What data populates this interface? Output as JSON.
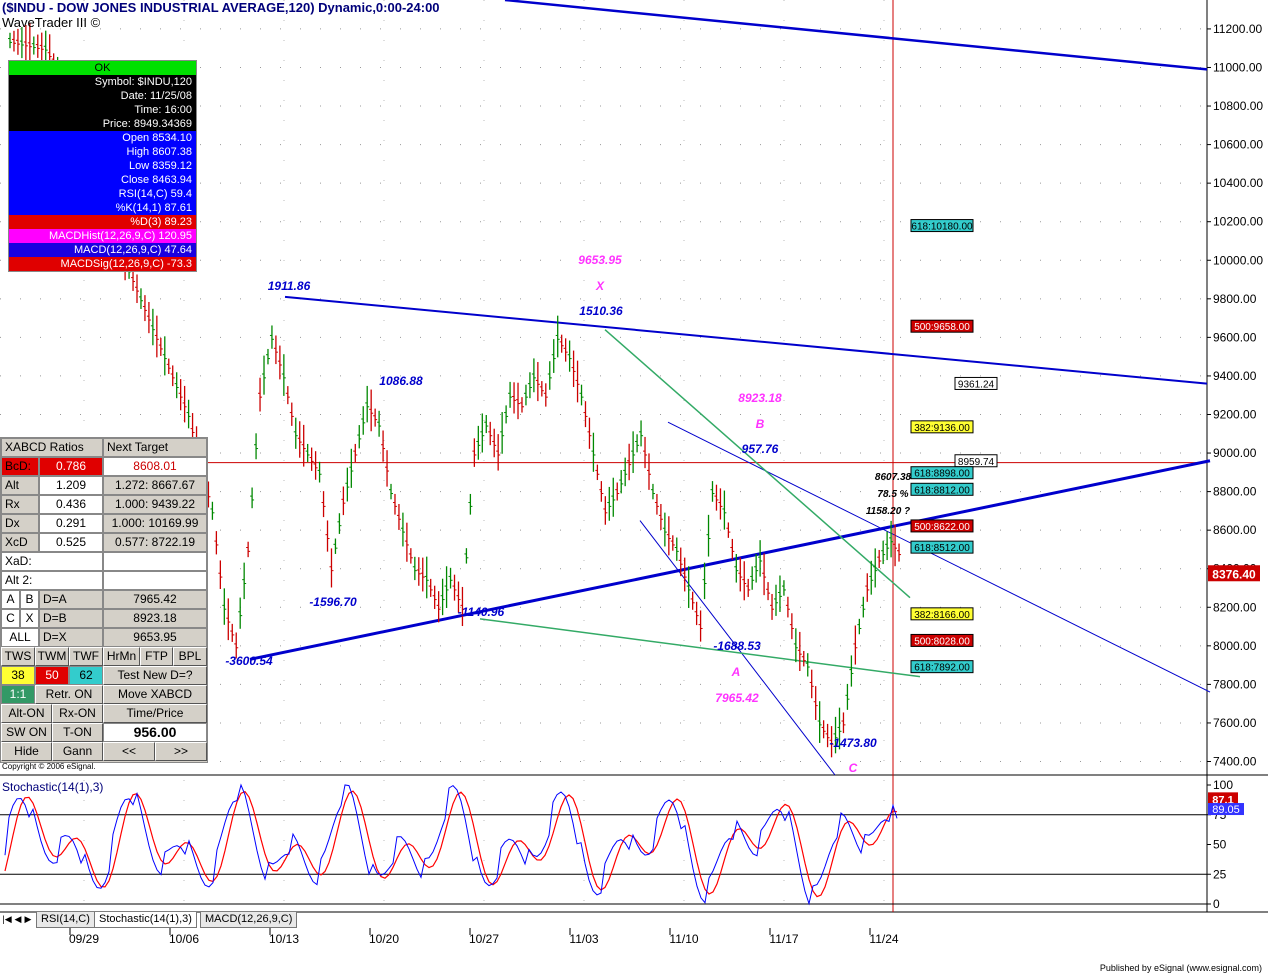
{
  "window": {
    "title": "($INDU - DOW JONES INDUSTRIAL AVERAGE,120) Dynamic,0:00-24:00",
    "study_name": "WaveTrader III ©",
    "copyright": "Copyright © 2006 eSignal.",
    "published": "Published by eSignal (www.esignal.com)"
  },
  "data_window": {
    "ok": "OK",
    "rows": [
      {
        "label": "Symbol: $INDU,120",
        "style": "blk"
      },
      {
        "label": "Date: 11/25/08",
        "style": "blk"
      },
      {
        "label": "Time: 16:00",
        "style": "blk"
      },
      {
        "label": "Price: 8949.34369",
        "style": "blk"
      },
      {
        "label": "Open 8534.10",
        "style": "blu"
      },
      {
        "label": "High 8607.38",
        "style": "blu"
      },
      {
        "label": "Low 8359.12",
        "style": "blu"
      },
      {
        "label": "Close 8463.94",
        "style": "blu"
      },
      {
        "label": "RSI(14,C) 59.4",
        "style": "blu"
      },
      {
        "label": "%K(14,1) 87.61",
        "style": "blu"
      },
      {
        "label": "%D(3) 89.23",
        "style": "red"
      },
      {
        "label": "MACDHist(12,26,9,C) 120.95",
        "style": "mag"
      },
      {
        "label": "MACD(12,26,9,C) 47.64",
        "style": "viol"
      },
      {
        "label": "MACDSig(12,26,9,C) -73.3",
        "style": "red"
      }
    ]
  },
  "xabcd": {
    "header": "XABCD Ratios",
    "next_target_label": "Next Target",
    "bcd_label": "BcD:",
    "bcd_value": "0.786",
    "next_target_value": "8608.01",
    "ratio_rows": [
      {
        "name": "Alt",
        "value": "1.209",
        "target": "1.272: 8667.67"
      },
      {
        "name": "Rx",
        "value": "0.436",
        "target": "1.000: 9439.22"
      },
      {
        "name": "Dx",
        "value": "0.291",
        "target": "1.000: 10169.99"
      },
      {
        "name": "XcD",
        "value": "0.525",
        "target": "0.577: 8722.19"
      }
    ],
    "xad_label": "XaD:",
    "alt2_label": "Alt 2:",
    "eq_rows": [
      {
        "k1": "A",
        "k2": "B",
        "eq": "D=A",
        "v": "7965.42"
      },
      {
        "k1": "C",
        "k2": "X",
        "eq": "D=B",
        "v": "8923.18"
      },
      {
        "k1": "ALL",
        "k2": "",
        "eq": "D=X",
        "v": "9653.95"
      }
    ],
    "buttons_row1": [
      "TWS",
      "TWM",
      "TWF",
      "HrMn",
      "FTP",
      "BPL"
    ],
    "buttons_row2_vals": [
      "38",
      "50",
      "62"
    ],
    "test_new": "Test New D=?",
    "ratio_btn": "1:1",
    "retr_on": "Retr. ON",
    "move_xabcd": "Move XABCD",
    "alt_on": "Alt-ON",
    "rx_on": "Rx-ON",
    "time_price": "Time/Price",
    "sw_on": "SW ON",
    "t_on": "T-ON",
    "time_price_value": "956.00",
    "hide": "Hide",
    "gann": "Gann",
    "prev": "<<",
    "next": ">>"
  },
  "tabs": [
    "RSI(14,C)",
    "Stochastic(14(1),3)",
    "MACD(12,26,9,C)"
  ],
  "stoch_panel": {
    "title": "Stochastic(14(1),3)",
    "k_value": "87.1",
    "d_value": "89.05"
  },
  "chart_data": [
    {
      "type": "ohlc",
      "title": "($INDU - DOW JONES INDUSTRIAL AVERAGE,120) Dynamic,0:00-24:00",
      "x_tick_labels": [
        "09/29",
        "10/06",
        "10/13",
        "10/20",
        "10/27",
        "11/03",
        "11/10",
        "11/17",
        "11/24"
      ],
      "y_tick_labels": [
        "11200.00",
        "11000.00",
        "10800.00",
        "10600.00",
        "10400.00",
        "10200.00",
        "10000.00",
        "9800.00",
        "9600.00",
        "9400.00",
        "9200.00",
        "9000.00",
        "8800.00",
        "8600.00",
        "8400.00",
        "8200.00",
        "8000.00",
        "7800.00",
        "7600.00",
        "7400.00"
      ],
      "ylim": [
        7330,
        11350
      ],
      "last_price": "8376.40",
      "price_series": [
        {
          "x": 0,
          "y": 11140
        },
        {
          "x": 3,
          "y": 11100
        },
        {
          "x": 5,
          "y": 10900
        },
        {
          "x": 7,
          "y": 10500
        },
        {
          "x": 9,
          "y": 10100
        },
        {
          "x": 11,
          "y": 9800
        },
        {
          "x": 13,
          "y": 9500
        },
        {
          "x": 15,
          "y": 9200
        },
        {
          "x": 17,
          "y": 8700
        },
        {
          "x": 18,
          "y": 8200
        },
        {
          "x": 19,
          "y": 8000
        },
        {
          "x": 20,
          "y": 8500
        },
        {
          "x": 21,
          "y": 9300
        },
        {
          "x": 22,
          "y": 9600
        },
        {
          "x": 23,
          "y": 9400
        },
        {
          "x": 24,
          "y": 9100
        },
        {
          "x": 26,
          "y": 8900
        },
        {
          "x": 27,
          "y": 8400
        },
        {
          "x": 28,
          "y": 8750
        },
        {
          "x": 29,
          "y": 9000
        },
        {
          "x": 30,
          "y": 9250
        },
        {
          "x": 31,
          "y": 9150
        },
        {
          "x": 32,
          "y": 8800
        },
        {
          "x": 33,
          "y": 8600
        },
        {
          "x": 34,
          "y": 8400
        },
        {
          "x": 35,
          "y": 8350
        },
        {
          "x": 36,
          "y": 8200
        },
        {
          "x": 37,
          "y": 8350
        },
        {
          "x": 38,
          "y": 8200
        },
        {
          "x": 39,
          "y": 9000
        },
        {
          "x": 40,
          "y": 9150
        },
        {
          "x": 41,
          "y": 9000
        },
        {
          "x": 42,
          "y": 9300
        },
        {
          "x": 43,
          "y": 9250
        },
        {
          "x": 44,
          "y": 9400
        },
        {
          "x": 45,
          "y": 9300
        },
        {
          "x": 46,
          "y": 9600
        },
        {
          "x": 47,
          "y": 9500
        },
        {
          "x": 48,
          "y": 9300
        },
        {
          "x": 49,
          "y": 9000
        },
        {
          "x": 50,
          "y": 8700
        },
        {
          "x": 51,
          "y": 8800
        },
        {
          "x": 52,
          "y": 8950
        },
        {
          "x": 53,
          "y": 9100
        },
        {
          "x": 54,
          "y": 8800
        },
        {
          "x": 55,
          "y": 8600
        },
        {
          "x": 56,
          "y": 8500
        },
        {
          "x": 57,
          "y": 8300
        },
        {
          "x": 58,
          "y": 8100
        },
        {
          "x": 59,
          "y": 8800
        },
        {
          "x": 60,
          "y": 8700
        },
        {
          "x": 61,
          "y": 8400
        },
        {
          "x": 62,
          "y": 8300
        },
        {
          "x": 63,
          "y": 8450
        },
        {
          "x": 64,
          "y": 8200
        },
        {
          "x": 65,
          "y": 8300
        },
        {
          "x": 66,
          "y": 8000
        },
        {
          "x": 67,
          "y": 7900
        },
        {
          "x": 68,
          "y": 7600
        },
        {
          "x": 69,
          "y": 7500
        },
        {
          "x": 70,
          "y": 7600
        },
        {
          "x": 71,
          "y": 8000
        },
        {
          "x": 72,
          "y": 8300
        },
        {
          "x": 73,
          "y": 8450
        },
        {
          "x": 74,
          "y": 8550
        },
        {
          "x": 75,
          "y": 8450
        }
      ],
      "annotations": [
        {
          "text": "1911.86",
          "color": "#0000cc",
          "price": 9800
        },
        {
          "text": "1086.88",
          "color": "#0000cc",
          "price": 9250
        },
        {
          "text": "1510.36",
          "color": "#0000cc",
          "price": 9650
        },
        {
          "text": "9653.95",
          "color": "#ff33ff",
          "price": 10000
        },
        {
          "text": "X",
          "color": "#ff33ff",
          "price": 9800
        },
        {
          "text": "8923.18",
          "color": "#ff33ff",
          "price": 9200
        },
        {
          "text": "B",
          "color": "#ff33ff",
          "price": 9050
        },
        {
          "text": "957.76",
          "color": "#0000cc",
          "price": 8940
        },
        {
          "text": "-3600.54",
          "color": "#0000cc",
          "price": 7920
        },
        {
          "text": "-1596.70",
          "color": "#0000cc",
          "price": 8150
        },
        {
          "text": "-1140.96",
          "color": "#0000cc",
          "price": 8090
        },
        {
          "text": "-1688.53",
          "color": "#0000cc",
          "price": 7910
        },
        {
          "text": "A",
          "color": "#ff33ff",
          "price": 7780
        },
        {
          "text": "7965.42",
          "color": "#ff33ff",
          "price": 7640
        },
        {
          "text": "-1473.80",
          "color": "#0000cc",
          "price": 7400
        },
        {
          "text": "C",
          "color": "#ff33ff",
          "price": 7320
        },
        {
          "text": "8607.38",
          "color": "#000000",
          "price": 8820
        },
        {
          "text": "78.5 %",
          "color": "#000000",
          "price": 8730
        },
        {
          "text": "1158.20 ?",
          "color": "#000000",
          "price": 8635
        }
      ],
      "level_boxes": [
        {
          "text": "618:10180.00",
          "color": "#33cccc",
          "price": 10180
        },
        {
          "text": "500:9658.00",
          "color": "#cc0000",
          "price": 9658
        },
        {
          "text": "9361.24",
          "color": "#ffffff",
          "price": 9361
        },
        {
          "text": "382:9136.00",
          "color": "#ffff33",
          "price": 9136
        },
        {
          "text": "8959.74",
          "color": "#ffffff",
          "price": 8960
        },
        {
          "text": "618:8898.00",
          "color": "#33cccc",
          "price": 8898
        },
        {
          "text": "618:8812.00",
          "color": "#33cccc",
          "price": 8812
        },
        {
          "text": "500:8622.00",
          "color": "#cc0000",
          "price": 8622
        },
        {
          "text": "618:8512.00",
          "color": "#33cccc",
          "price": 8512
        },
        {
          "text": "382:8166.00",
          "color": "#ffff33",
          "price": 8166
        },
        {
          "text": "500:8028.00",
          "color": "#cc0000",
          "price": 8028
        },
        {
          "text": "618:7892.00",
          "color": "#33cccc",
          "price": 7892
        }
      ]
    },
    {
      "type": "line",
      "title": "Stochastic(14(1),3)",
      "y_tick_labels": [
        "100",
        "75",
        "50",
        "25",
        "0"
      ],
      "ylim": [
        0,
        100
      ],
      "series": [
        {
          "name": "%K",
          "color": "#0000ff"
        },
        {
          "name": "%D",
          "color": "#ff0000"
        }
      ]
    }
  ],
  "colors": {
    "trend_blue": "#0000cc",
    "green_line": "#33aa66",
    "cursor_red": "#cc0000",
    "price_green": "#008800",
    "price_red": "#cc0000"
  }
}
